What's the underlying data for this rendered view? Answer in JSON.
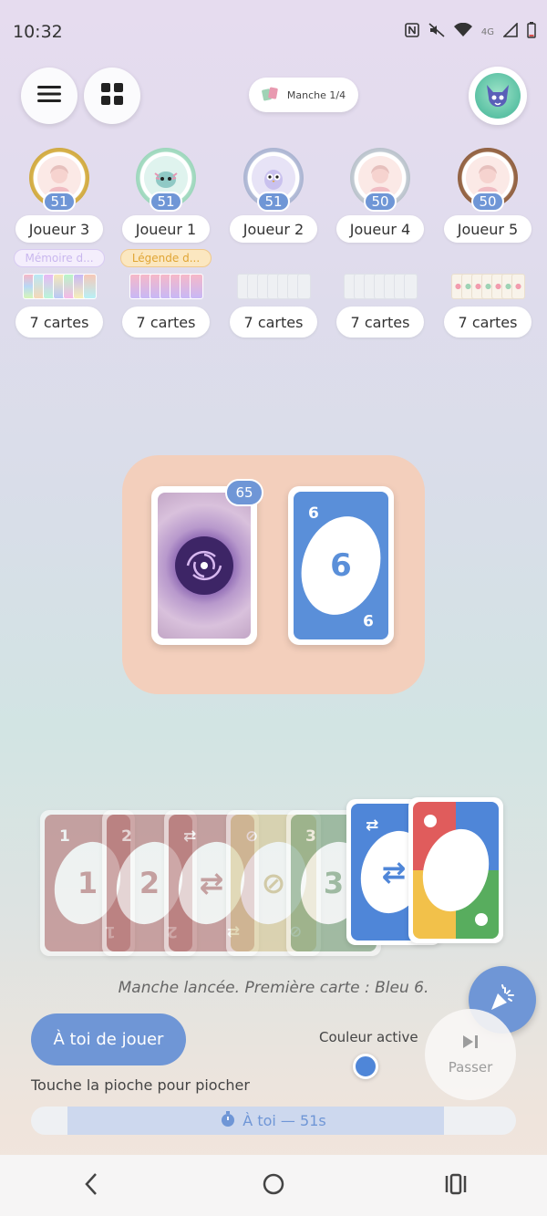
{
  "status_bar": {
    "time": "10:32",
    "network": "4G",
    "icons": [
      "nfc-icon",
      "mute-icon",
      "wifi-icon",
      "signal-icon",
      "battery-icon"
    ]
  },
  "header": {
    "menu_icon": "hamburger-icon",
    "grid_icon": "grid-icon",
    "round_label": "Manche 1/4",
    "profile_avatar": "fox-avatar-icon"
  },
  "players": [
    {
      "name": "Joueur 3",
      "score": "51",
      "frame_color": "#d8b24a",
      "title": "Mémoire d...",
      "title_color": "#c9b7ee",
      "title_bg": "#f4eefc",
      "card_count": "7 cartes",
      "cards_style": "rainbow"
    },
    {
      "name": "Joueur 1",
      "score": "51",
      "frame_color": "#8fd1b3",
      "title": "Légende d...",
      "title_color": "#e0a534",
      "title_bg": "#fbe7c0",
      "card_count": "7 cartes",
      "cards_style": "rainbow"
    },
    {
      "name": "Joueur 2",
      "score": "51",
      "frame_color": "#9aa6c9",
      "title": "",
      "card_count": "7 cartes",
      "cards_style": "plain"
    },
    {
      "name": "Joueur 4",
      "score": "50",
      "frame_color": "#aab4c0",
      "title": "",
      "card_count": "7 cartes",
      "cards_style": "plain"
    },
    {
      "name": "Joueur 5",
      "score": "50",
      "frame_color": "#8a5a3b",
      "title": "",
      "card_count": "7 cartes",
      "cards_style": "floral"
    }
  ],
  "table": {
    "deck_count": "65",
    "discard": {
      "value": "6",
      "corner_top": "6",
      "corner_bottom": "9",
      "color": "#5a8fd9"
    }
  },
  "hand": [
    {
      "label": "1",
      "corner": "1",
      "color": "#b36b6b",
      "dim": true
    },
    {
      "label": "2",
      "corner": "2",
      "color": "#b36b6b",
      "dim": true
    },
    {
      "label": "⇄",
      "corner": "⇄",
      "color": "#b36b6b",
      "dim": true
    },
    {
      "label": "⊘",
      "corner": "⊘",
      "color": "#d7c58a",
      "dim": true
    },
    {
      "label": "3",
      "corner": "3",
      "color": "#6f9a6f",
      "dim": true
    },
    {
      "label": "⇄",
      "corner": "⇄",
      "color": "#4f86d8",
      "dim": false
    },
    {
      "label": "",
      "corner": "",
      "color": "wild",
      "dim": false
    }
  ],
  "announcement": "Manche lancée. Première carte : Bleu 6.",
  "controls": {
    "turn_label": "À toi de jouer",
    "hint": "Touche la pioche pour piocher",
    "active_color_label": "Couleur active",
    "active_color": "#4f86d8",
    "pass_label": "Passer",
    "timer_text": "À toi — 51s",
    "timer_fraction": 0.85
  }
}
